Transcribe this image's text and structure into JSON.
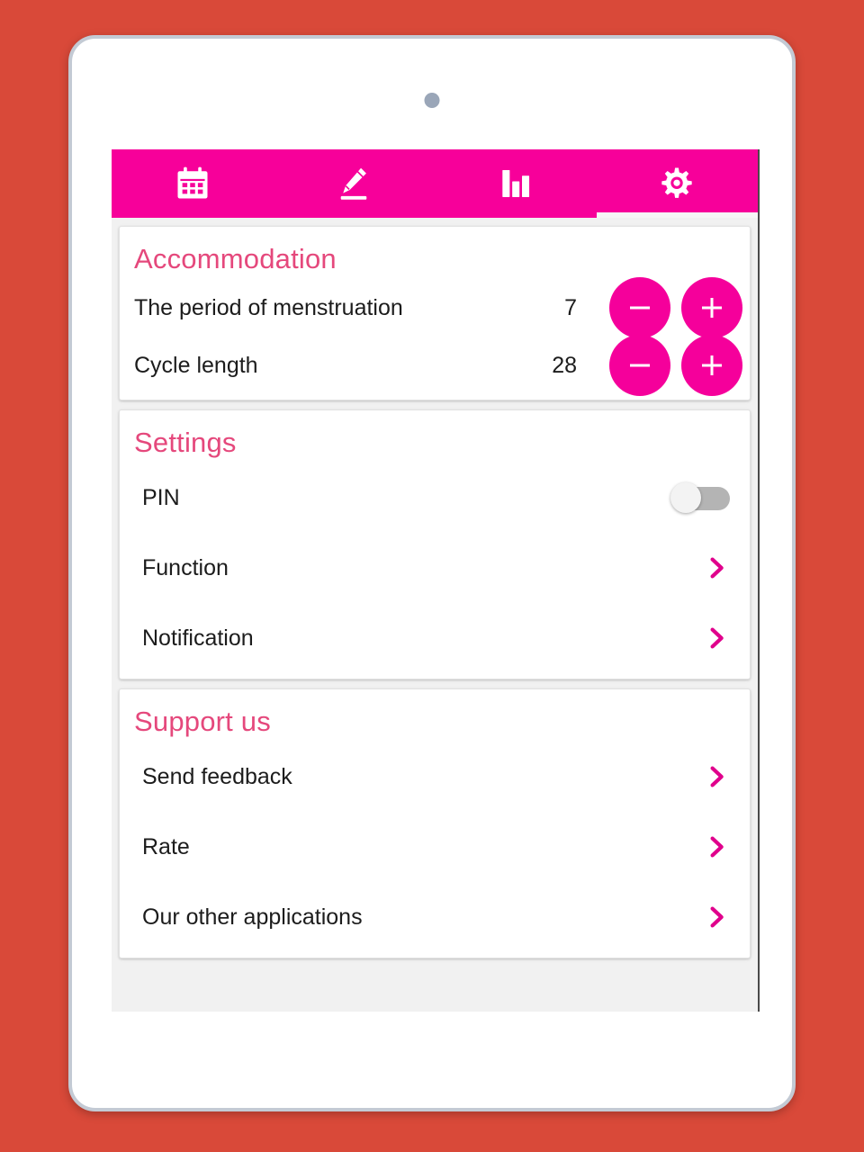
{
  "device": {
    "camera_icon": "camera-dot"
  },
  "colors": {
    "background": "#d94939",
    "header_pink": "#f7009a",
    "accent_pink": "#f5009b",
    "card_title_pink": "#e5487c",
    "chevron_pink": "#e0008c",
    "toggle_track_off": "#b4b4b4",
    "toggle_knob": "#f3f3f3"
  },
  "tabs": [
    {
      "id": "tab-calendar",
      "icon": "calendar-icon",
      "active": false
    },
    {
      "id": "tab-notes",
      "icon": "pencil-edit-icon",
      "active": false
    },
    {
      "id": "tab-statistics",
      "icon": "bar-chart-icon",
      "active": false
    },
    {
      "id": "tab-settings",
      "icon": "gear-icon",
      "active": true
    }
  ],
  "cards": {
    "accommodation": {
      "title": "Accommodation",
      "rows": [
        {
          "label": "The period of menstruation",
          "value": "7",
          "decrement_label": "−",
          "increment_label": "+"
        },
        {
          "label": "Cycle length",
          "value": "28",
          "decrement_label": "−",
          "increment_label": "+"
        }
      ]
    },
    "settings": {
      "title": "Settings",
      "rows": [
        {
          "label": "PIN",
          "control": "toggle",
          "toggle_state": "off"
        },
        {
          "label": "Function",
          "control": "chevron"
        },
        {
          "label": "Notification",
          "control": "chevron"
        }
      ]
    },
    "support": {
      "title": "Support us",
      "rows": [
        {
          "label": "Send feedback",
          "control": "chevron"
        },
        {
          "label": "Rate",
          "control": "chevron"
        },
        {
          "label": "Our other applications",
          "control": "chevron"
        }
      ]
    }
  }
}
